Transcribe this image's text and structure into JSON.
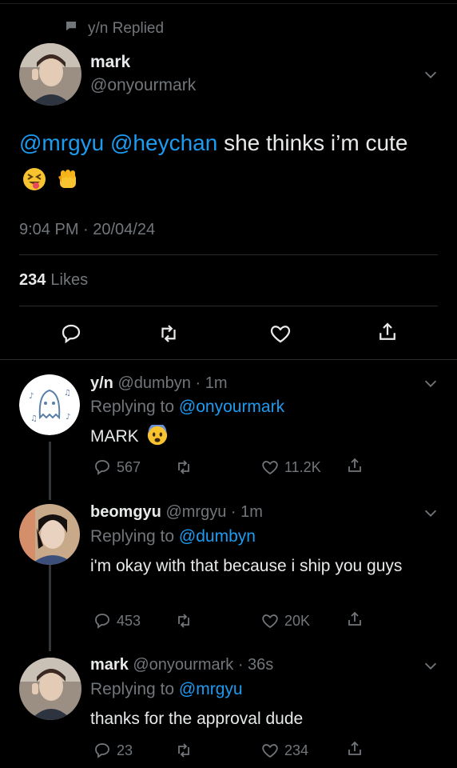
{
  "context": {
    "replied_label": "y/n Replied"
  },
  "main_tweet": {
    "name": "mark",
    "handle": "@onyourmark",
    "mention1": "@mrgyu",
    "mention2": "@heychan",
    "text": "she thinks i’m cute",
    "timestamp": "9:04 PM · 20/04/24",
    "likes_count": "234",
    "likes_label": "Likes",
    "emojis": [
      "squinting-tongue-emoji",
      "fist-emoji"
    ]
  },
  "replies": [
    {
      "name": "y/n",
      "handle_time": "@dumbyn · 1m",
      "replying_label": "Replying to",
      "replying_to": "@onyourmark",
      "text": "MARK",
      "emoji": "fearful-face-emoji",
      "reply_count": "567",
      "like_count": "11.2K"
    },
    {
      "name": "beomgyu",
      "handle_time": "@mrgyu · 1m",
      "replying_label": "Replying to",
      "replying_to": "@dumbyn",
      "text": "i'm okay with that because i ship you guys",
      "reply_count": "453",
      "like_count": "20K"
    },
    {
      "name": "mark",
      "handle_time": "@onyourmark · 36s",
      "replying_label": "Replying to",
      "replying_to": "@mrgyu",
      "text": "thanks for the approval dude",
      "reply_count": "23",
      "like_count": "234"
    }
  ],
  "colors": {
    "background": "#000000",
    "text": "#e7e9ea",
    "muted": "#71767b",
    "accent": "#1d9bf0"
  }
}
